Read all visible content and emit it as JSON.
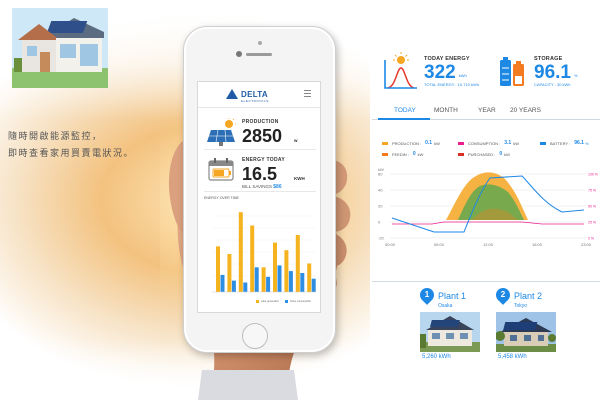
{
  "tagline": {
    "line1": "隨時開啟能源監控，",
    "line2": "即時查看家用買賣電狀況。"
  },
  "app": {
    "brand": "DELTA",
    "brand_sub": "ELECTRONICS",
    "production": {
      "label": "PRODUCTION",
      "value": "2850",
      "unit": "w"
    },
    "energy_today": {
      "label": "ENERGY TODAY",
      "value": "16.5",
      "unit": "KWH",
      "bill_label": "BILL SAVINGS",
      "bill_value": "$86"
    },
    "energy_chart": {
      "title": "ENERGY OVER TIME",
      "legend_generation": "solar generation",
      "legend_consumption": "home consumption",
      "generation": [
        48,
        40,
        84,
        70,
        26,
        52,
        44,
        60,
        30
      ],
      "consumption": [
        18,
        12,
        10,
        26,
        16,
        28,
        22,
        20,
        14
      ]
    }
  },
  "dashboard": {
    "today_energy": {
      "label": "TODAY ENERGY",
      "value": "322",
      "unit": "kWh",
      "sub": "TOTAL ENERGY : 10,710 kWh"
    },
    "storage": {
      "label": "STORAGE",
      "value": "96.1",
      "unit": "%",
      "sub": "CAPACITY : 30 kWh"
    },
    "tabs": [
      "TODAY",
      "MONTH",
      "YEAR",
      "20 YEARS"
    ],
    "active_tab": "TODAY",
    "legend": {
      "production": {
        "label": "PRODUCTION :",
        "value": "0.1",
        "unit": "kW"
      },
      "consumption": {
        "label": "CONSUMPTION :",
        "value": "3.1",
        "unit": "kW"
      },
      "battery": {
        "label": "BATTERY :",
        "value": "96.1",
        "unit": "%"
      },
      "feedin": {
        "label": "FEEDIN :",
        "value": "0",
        "unit": "kW"
      },
      "purchased": {
        "label": "PURCHASED :",
        "value": "0",
        "unit": "kW"
      }
    },
    "chart": {
      "left_axis_unit": "kW",
      "left_ticks": [
        "60",
        "40",
        "20",
        "0",
        "-20"
      ],
      "right_ticks": [
        "100 %",
        "75 %",
        "50 %",
        "25 %",
        "0 %"
      ],
      "x_ticks": [
        "00:00",
        "06:00",
        "12:00",
        "18:00",
        "23:00"
      ],
      "colors": {
        "production": "#f5a623",
        "consumption": "#e91e8c",
        "battery": "#1e88e5",
        "feedin": "#f47b20",
        "purchased": "#d93025",
        "green": "#6aa84f"
      }
    },
    "plants": [
      {
        "number": "1",
        "name": "Plant 1",
        "city": "Osaka",
        "kwh": "5,260 kWh"
      },
      {
        "number": "2",
        "name": "Plant 2",
        "city": "Tokyo",
        "kwh": "5,458 kWh"
      }
    ]
  }
}
